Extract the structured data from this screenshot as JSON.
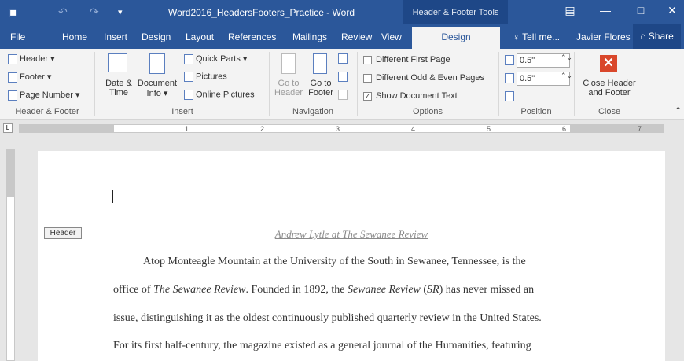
{
  "titlebar": {
    "title": "Word2016_HeadersFooters_Practice - Word",
    "context_tab": "Header & Footer Tools",
    "save_icon": "▣",
    "undo_icon": "↶",
    "redo_icon": "↷",
    "qat_icon": "▾",
    "ribbon_display_icon": "▤",
    "minimize_icon": "—",
    "maximize_icon": "□",
    "close_icon": "✕"
  },
  "tabs": {
    "file": "File",
    "home": "Home",
    "insert": "Insert",
    "design1": "Design",
    "layout": "Layout",
    "references": "References",
    "mailings": "Mailings",
    "review": "Review",
    "view": "View",
    "design_active": "Design",
    "tellme": "♀ Tell me...",
    "user": "Javier Flores",
    "share": "⌂ Share"
  },
  "ribbon": {
    "hf": {
      "header": "Header ▾",
      "footer": "Footer ▾",
      "page_number": "Page Number ▾",
      "group": "Header & Footer"
    },
    "insert": {
      "date_time_1": "Date &",
      "date_time_2": "Time",
      "doc_info_1": "Document",
      "doc_info_2": "Info ▾",
      "quick_parts": "Quick Parts ▾",
      "pictures": "Pictures",
      "online_pictures": "Online Pictures",
      "group": "Insert"
    },
    "navigation": {
      "goto_header_1": "Go to",
      "goto_header_2": "Header",
      "goto_footer_1": "Go to",
      "goto_footer_2": "Footer",
      "group": "Navigation"
    },
    "options": {
      "diff_first": "Different First Page",
      "diff_odd_even": "Different Odd & Even Pages",
      "show_doc_text": "Show Document Text",
      "checkmark": "✓",
      "group": "Options"
    },
    "position": {
      "header_value": "0.5\"",
      "footer_value": "0.5\"",
      "spin": "⌃⌄",
      "group": "Position"
    },
    "close": {
      "x": "✕",
      "label_1": "Close Header",
      "label_2": "and Footer",
      "group": "Close"
    },
    "collapse": "⌃"
  },
  "ruler": {
    "corner": "L",
    "n1": "1",
    "n2": "2",
    "n3": "3",
    "n4": "4",
    "n5": "5",
    "n6": "6",
    "n7": "7"
  },
  "document": {
    "header_tag": "Header",
    "header_text": "Andrew Lytle at The Sewanee Review",
    "line1": "Atop Monteagle Mountain at the University of the South in Sewanee, Tennessee, is the",
    "line2_a": "office of ",
    "line2_b": "The Sewanee Review",
    "line2_c": ". Founded in 1892, the ",
    "line2_d": "Sewanee Review",
    "line2_e": " (",
    "line2_f": "SR",
    "line2_g": ") has never missed an",
    "line3": "issue, distinguishing it as the oldest continuously published quarterly review in the United States.",
    "line4": "For its first half-century, the magazine existed as a general journal of the Humanities, featuring"
  }
}
